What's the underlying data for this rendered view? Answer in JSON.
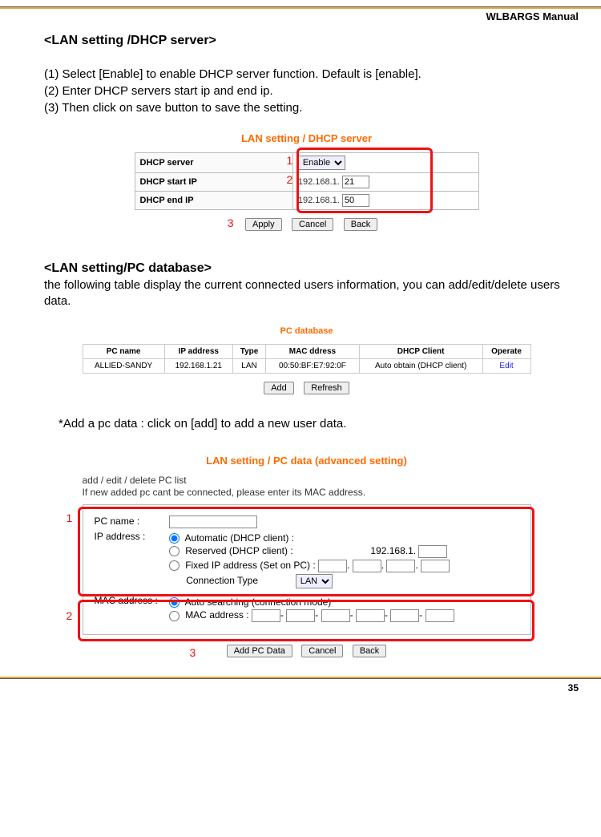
{
  "header": {
    "manual_title": "WLBARGS Manual"
  },
  "page_number": "35",
  "section1": {
    "heading": "<LAN setting /DHCP server>",
    "steps": {
      "s1": "(1) Select [Enable] to enable DHCP server function. Default is [enable].",
      "s2": "(2) Enter DHCP servers start ip and end ip.",
      "s3": "(3) Then click on save button to save the setting."
    },
    "panel_title": "LAN setting / DHCP server",
    "rows": {
      "r1_label": "DHCP server",
      "r1_select": "Enable",
      "r2_label": "DHCP start IP",
      "r2_prefix": "192.168.1.",
      "r2_val": "21",
      "r3_label": "DHCP end IP",
      "r3_prefix": "192.168.1.",
      "r3_val": "50"
    },
    "buttons": {
      "apply": "Apply",
      "cancel": "Cancel",
      "back": "Back"
    },
    "callouts": {
      "c1": "1",
      "c2": "2",
      "c3": "3"
    }
  },
  "section2": {
    "heading": "<LAN setting/PC database>",
    "desc": "the following table display the current connected users information, you can add/edit/delete users data.",
    "panel_title": "PC database",
    "headers": {
      "h1": "PC name",
      "h2": "IP address",
      "h3": "Type",
      "h4": "MAC ddress",
      "h5": "DHCP Client",
      "h6": "Operate"
    },
    "row": {
      "c1": "ALLIED-SANDY",
      "c2": "192.168.1.21",
      "c3": "LAN",
      "c4": "00:50:BF:E7:92:0F",
      "c5": "Auto obtain (DHCP client)",
      "c6": "Edit"
    },
    "buttons": {
      "add": "Add",
      "refresh": "Refresh"
    }
  },
  "add_note": "*Add a pc data : click on [add] to add a new user data.",
  "section3": {
    "panel_title": "LAN setting / PC data (advanced setting)",
    "intro1": "add / edit / delete PC list",
    "intro2": "If new added pc cant be connected, please enter its MAC address.",
    "labels": {
      "pcname": "PC name :",
      "ipaddr": "IP address :",
      "auto": "Automatic (DHCP client) :",
      "reserved": "Reserved (DHCP client) :",
      "reserved_prefix": "192.168.1.",
      "fixed": "Fixed IP address (Set on PC) :",
      "conn_type": "Connection Type",
      "conn_type_val": "LAN",
      "mac_label": "MAC address :",
      "auto_search": "Auto searching (connection mode)",
      "mac_addr": "MAC address :"
    },
    "buttons": {
      "addpc": "Add PC Data",
      "cancel": "Cancel",
      "back": "Back"
    },
    "callouts": {
      "c1": "1",
      "c2": "2",
      "c3": "3"
    }
  }
}
